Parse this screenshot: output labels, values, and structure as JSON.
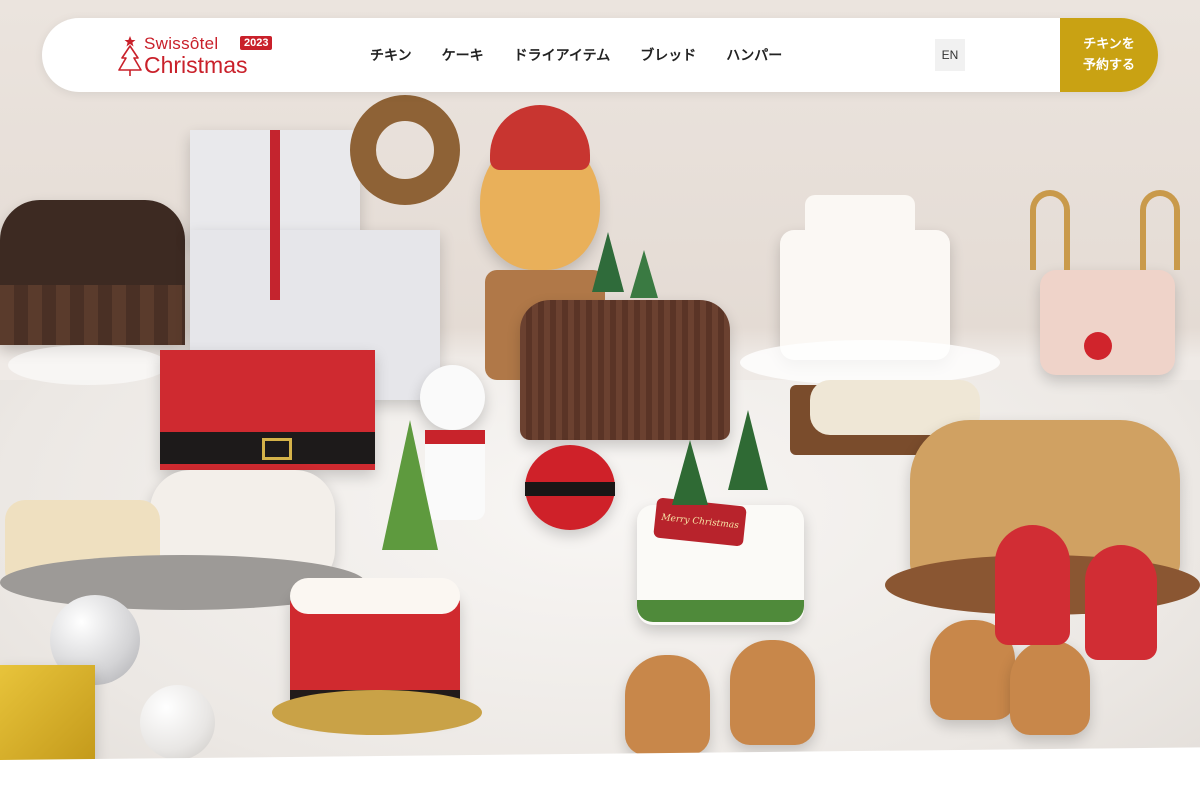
{
  "brand": {
    "name_top": "Swissôtel",
    "year": "2023",
    "name_main": "Christmas"
  },
  "nav": {
    "items": [
      "チキン",
      "ケーキ",
      "ドライアイテム",
      "ブレッド",
      "ハンパー"
    ]
  },
  "lang_switch": "EN",
  "cta": {
    "line1": "チキンを",
    "line2": "予約する"
  },
  "hero": {
    "plaque_text": "Merry Christmas"
  },
  "colors": {
    "brand_red": "#c9202a",
    "cta_gold": "#c9a213"
  },
  "icons": [
    "christmas-tree-icon"
  ]
}
